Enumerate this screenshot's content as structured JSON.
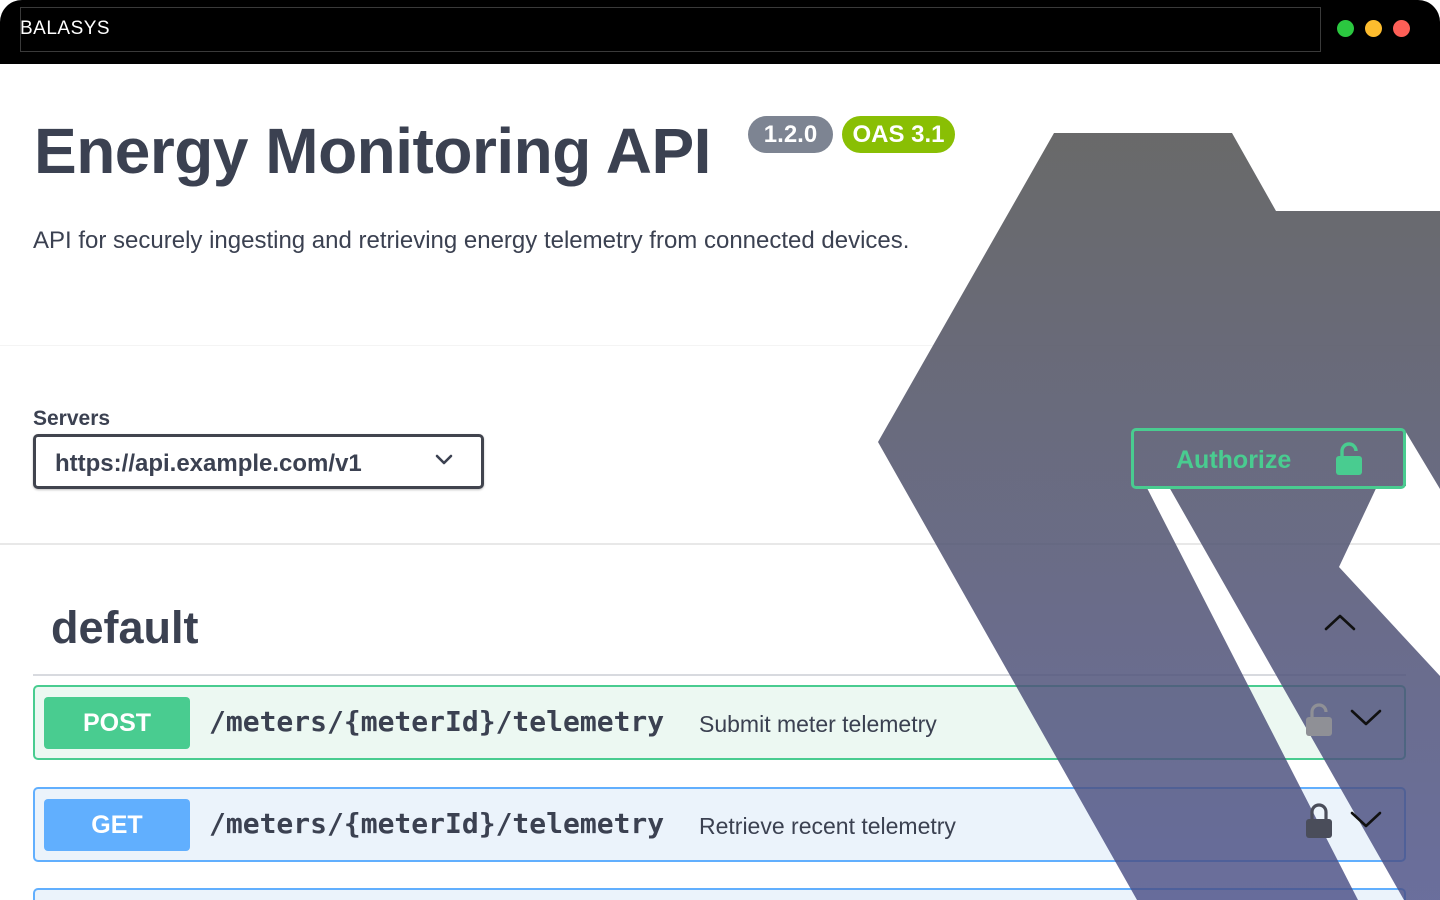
{
  "window": {
    "title": "BALASYS"
  },
  "info": {
    "title": "Energy Monitoring API",
    "version": "1.2.0",
    "oas_version": "OAS 3.1",
    "description": "API for securely ingesting and retrieving energy telemetry from connected devices."
  },
  "servers": {
    "label": "Servers",
    "selected": "https://api.example.com/v1"
  },
  "authorize": {
    "label": "Authorize",
    "icon": "unlocked-lock-icon"
  },
  "tag": {
    "name": "default",
    "expanded": true
  },
  "operations": [
    {
      "method": "POST",
      "path": "/meters/{meterId}/telemetry",
      "summary": "Submit meter telemetry",
      "lock_icon": "lock-icon",
      "expand_icon": "chevron-down-icon"
    },
    {
      "method": "GET",
      "path": "/meters/{meterId}/telemetry",
      "summary": "Retrieve recent telemetry",
      "lock_icon": "lock-icon",
      "expand_icon": "chevron-down-icon"
    }
  ],
  "colors": {
    "title_bar": "#000000",
    "post": "#49cc90",
    "get": "#61affe",
    "version_badge": "#7d8492",
    "oas_badge": "#89bf04",
    "text": "#3b4151",
    "window_close": "#fe5f57",
    "window_minimize": "#fdbc2e",
    "window_maximize": "#2bc840"
  }
}
